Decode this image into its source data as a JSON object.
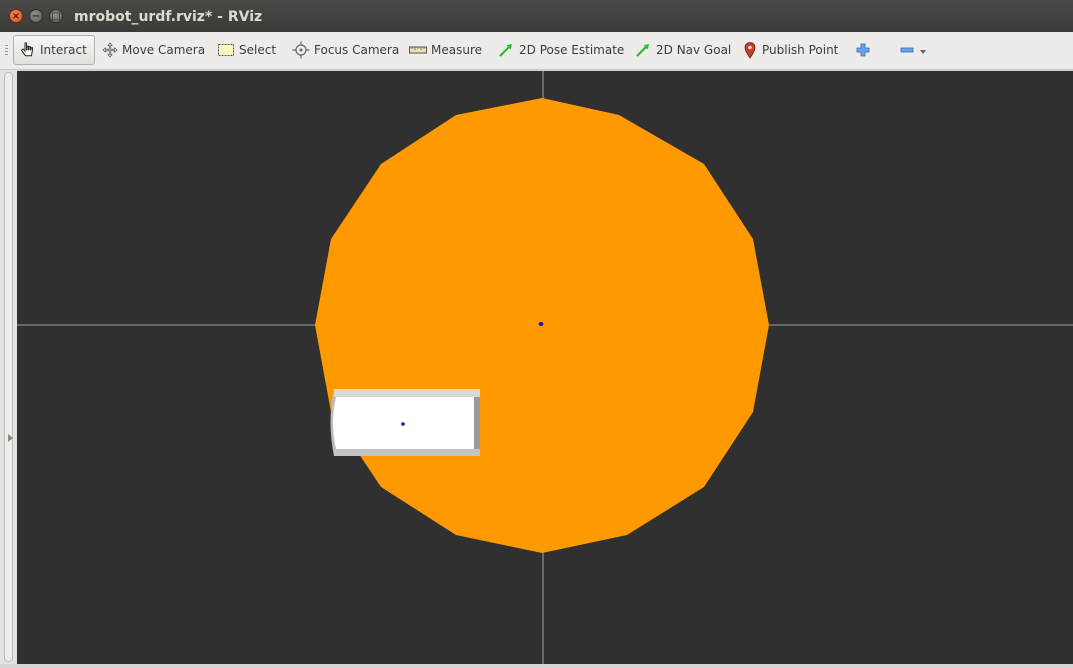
{
  "window": {
    "title": "mrobot_urdf.rviz* - RViz",
    "close_glyph": "×",
    "minimize_glyph": "−",
    "maximize_glyph": "□"
  },
  "toolbar": {
    "tools": [
      {
        "label": "Interact",
        "icon": "hand-pointer-icon"
      },
      {
        "label": "Move Camera",
        "icon": "move-camera-icon"
      },
      {
        "label": "Select",
        "icon": "select-rect-icon"
      },
      {
        "label": "Focus Camera",
        "icon": "focus-crosshair-icon"
      },
      {
        "label": "Measure",
        "icon": "ruler-icon"
      },
      {
        "label": "2D Pose Estimate",
        "icon": "green-arrow-icon"
      },
      {
        "label": "2D Nav Goal",
        "icon": "green-arrow-icon"
      },
      {
        "label": "Publish Point",
        "icon": "map-pin-icon"
      }
    ],
    "add_tool_icon": "plus-icon",
    "remove_tool_icon": "minus-icon",
    "menu_icon": "chevron-down-icon",
    "active_tool": "Interact"
  },
  "scene": {
    "robot_base_color": "#ff9900",
    "wheel_color": "#ffffff",
    "background_color": "#303030",
    "grid_color": "#a0a0a0",
    "frame_marker_color": "#0000cc"
  }
}
